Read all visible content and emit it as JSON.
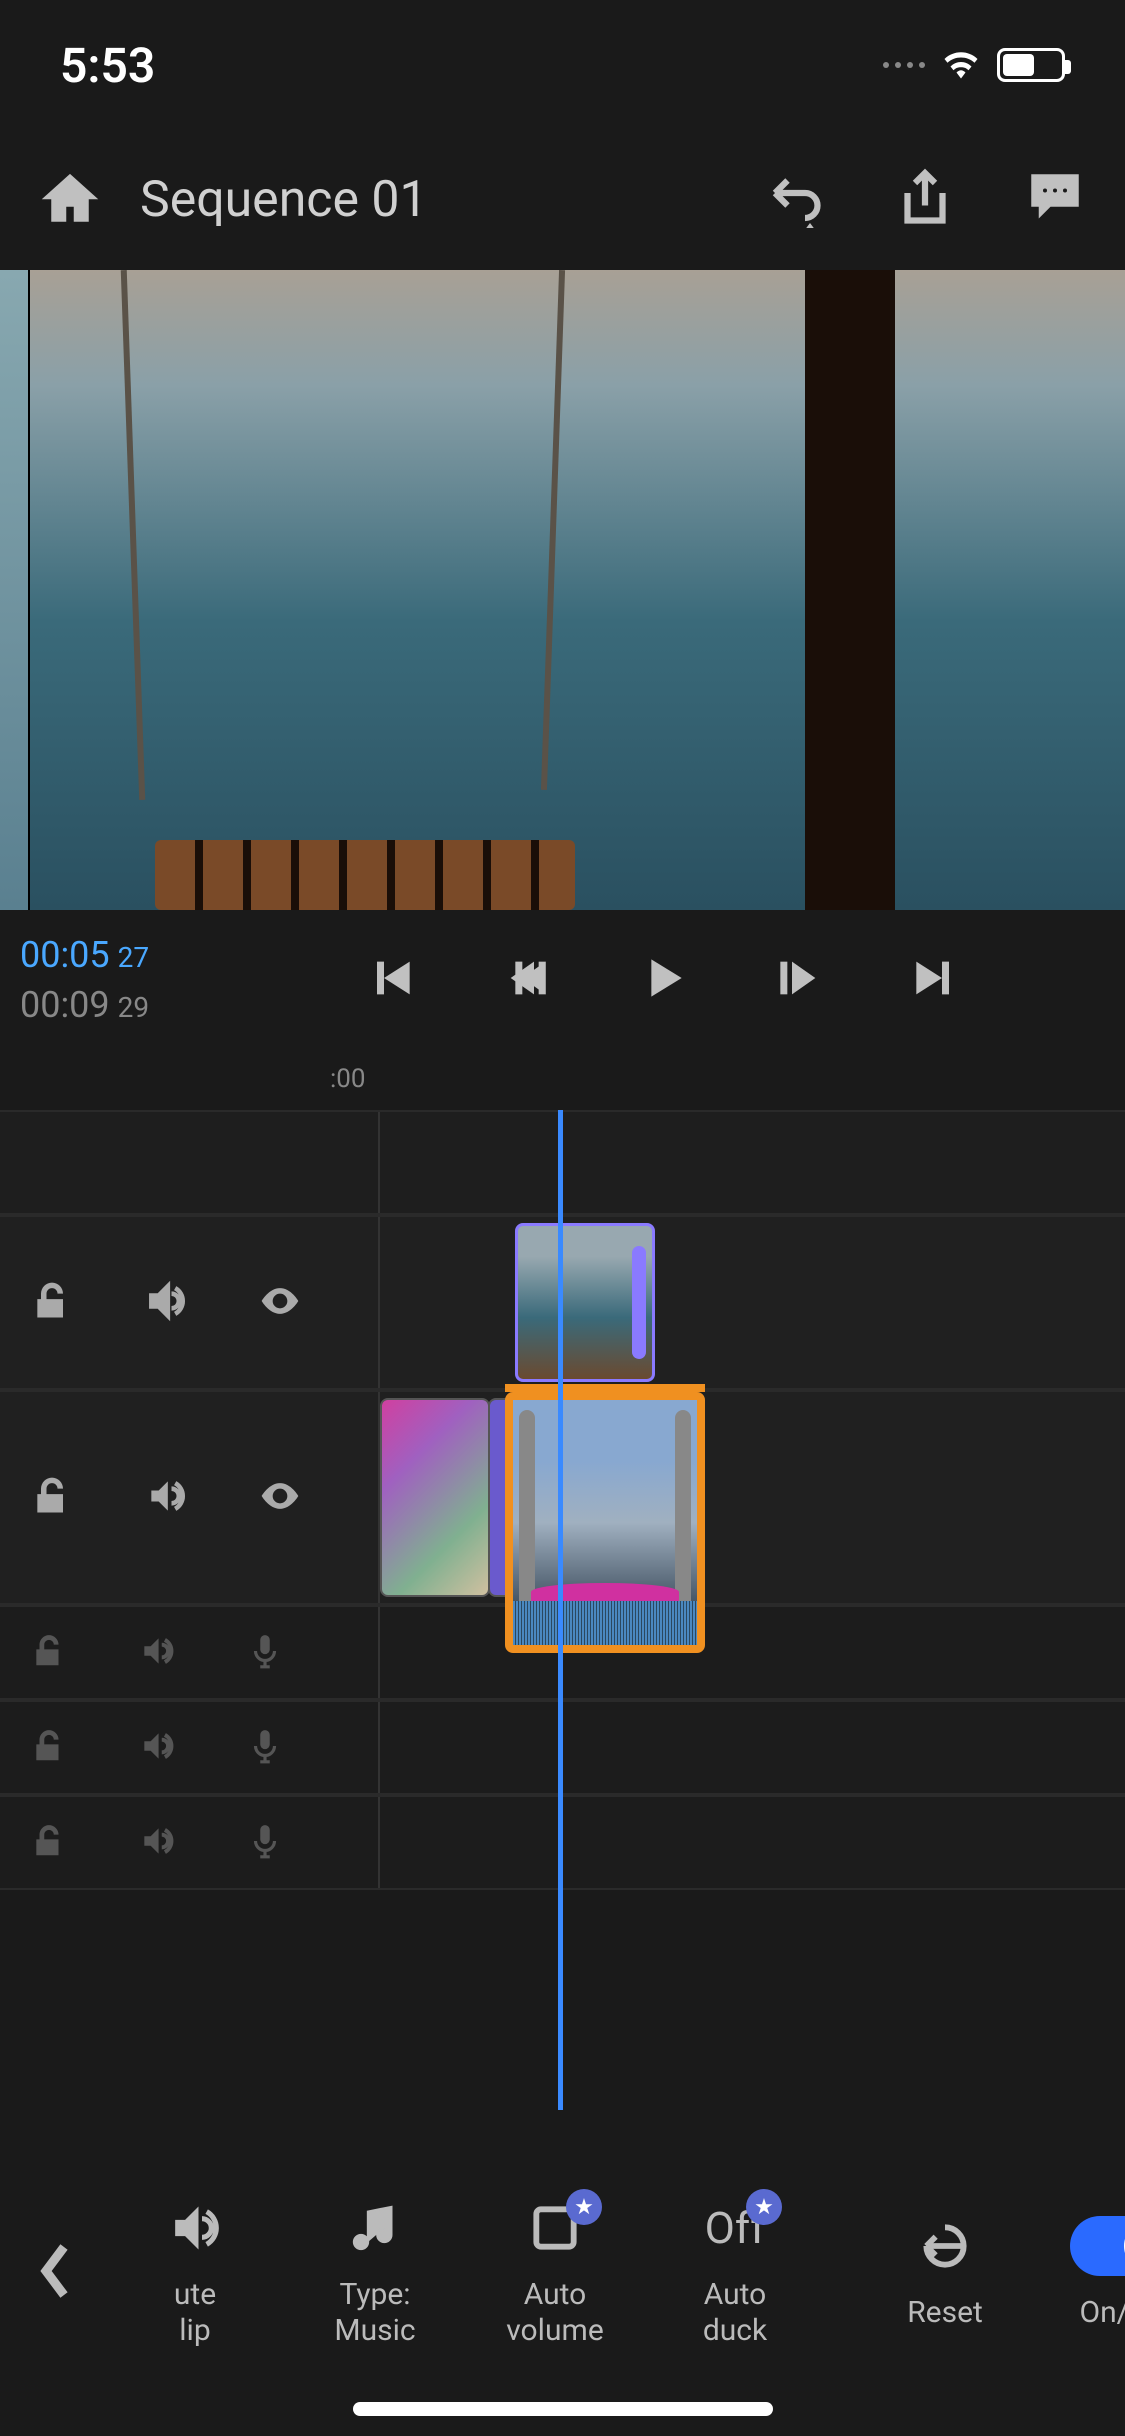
{
  "status": {
    "time": "5:53"
  },
  "header": {
    "title": "Sequence 01"
  },
  "playback": {
    "current_time": "00:05",
    "current_frames": "27",
    "total_time": "00:09",
    "total_frames": "29"
  },
  "ruler": {
    "mark0": ":00"
  },
  "toolbar": {
    "mute_clip_label": "ute\nlip",
    "type_label": "Type:\nMusic",
    "auto_volume_label": "Auto\nvolume",
    "auto_duck_text": "Off",
    "auto_duck_label": "Auto\nduck",
    "reset_label": "Reset",
    "onoff_label": "On/Off"
  }
}
